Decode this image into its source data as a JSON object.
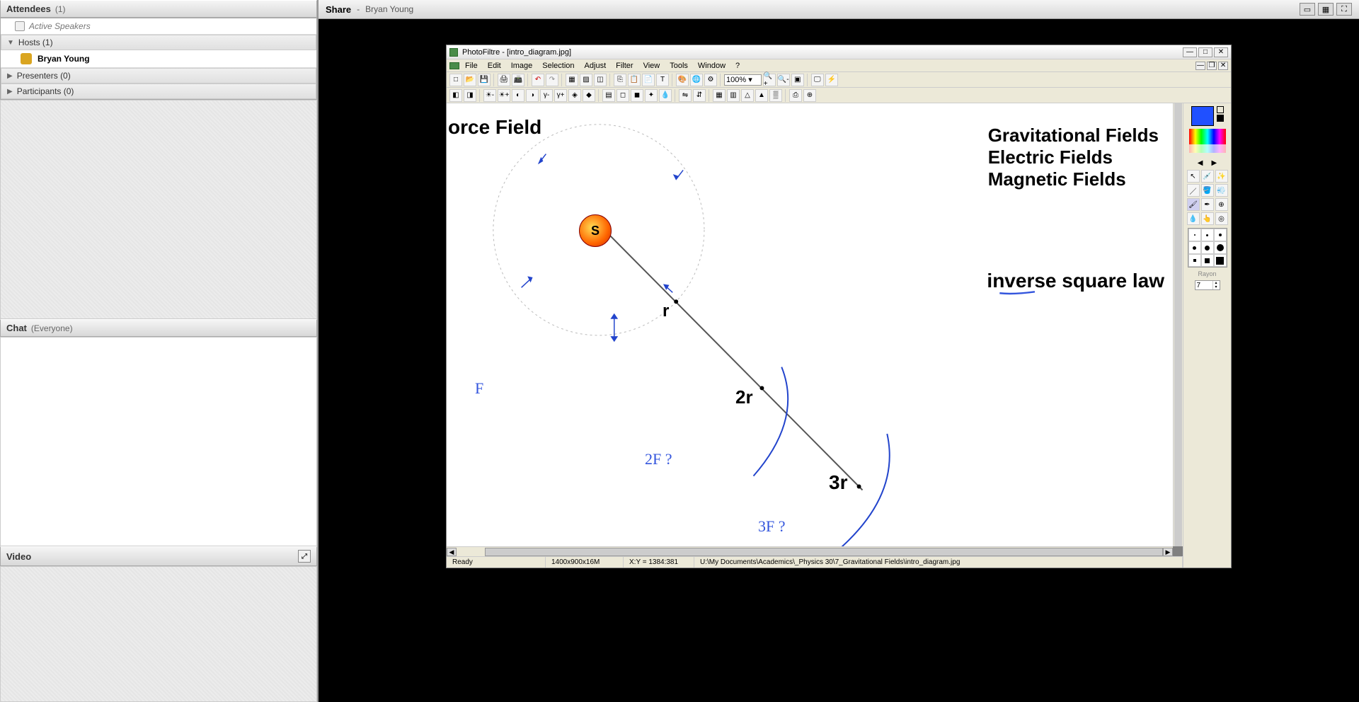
{
  "attendees": {
    "panel_title": "Attendees",
    "panel_count": "(1)",
    "active_speakers_label": "Active Speakers",
    "hosts_label": "Hosts (1)",
    "host_name": "Bryan Young",
    "presenters_label": "Presenters (0)",
    "participants_label": "Participants (0)"
  },
  "chat": {
    "panel_title": "Chat",
    "panel_scope": "(Everyone)"
  },
  "video": {
    "panel_title": "Video"
  },
  "share": {
    "title": "Share",
    "presenter_prefix": "- ",
    "presenter": "Bryan Young"
  },
  "pf": {
    "app_title": "PhotoFiltre - [intro_diagram.jpg]",
    "menu": {
      "file": "File",
      "edit": "Edit",
      "image": "Image",
      "selection": "Selection",
      "adjust": "Adjust",
      "filter": "Filter",
      "view": "View",
      "tools": "Tools",
      "window": "Window",
      "help": "?"
    },
    "zoom": "100%",
    "status": {
      "ready": "Ready",
      "dims": "1400x900x16M",
      "xy": "X:Y = 1384:381",
      "path": "U:\\My Documents\\Academics\\_Physics 30\\7_Gravitational Fields\\intro_diagram.jpg"
    },
    "tools_panel": {
      "rayon_label": "Rayon",
      "rayon_value": "7"
    }
  },
  "canvas": {
    "title_left": "orce Field",
    "fields": {
      "grav": "Gravitational Fields",
      "elec": "Electric Fields",
      "mag": "Magnetic Fields"
    },
    "inverse_sq": "inverse square law",
    "sun_label": "S",
    "r_label": "r",
    "r2_label": "2r",
    "r3_label": "3r",
    "F_label": "F",
    "q2f": "2F ?",
    "q3f": "3F ?"
  }
}
